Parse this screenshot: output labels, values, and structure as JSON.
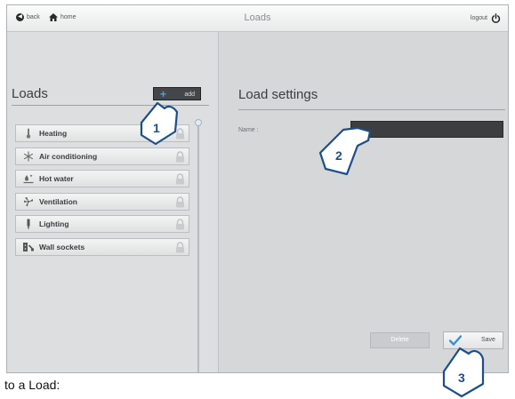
{
  "topbar": {
    "back_label": "back",
    "home_label": "home",
    "title": "Loads",
    "logout_label": "logout"
  },
  "loads_panel": {
    "heading": "Loads",
    "add_label": "add",
    "items": [
      {
        "label": "Heating",
        "icon": "thermometer-icon"
      },
      {
        "label": "Air conditioning",
        "icon": "snowflake-icon"
      },
      {
        "label": "Hot water",
        "icon": "water-heater-icon"
      },
      {
        "label": "Ventilation",
        "icon": "fan-icon"
      },
      {
        "label": "Lighting",
        "icon": "lamp-icon"
      },
      {
        "label": "Wall sockets",
        "icon": "socket-icon"
      }
    ]
  },
  "settings_panel": {
    "heading": "Load settings",
    "name_label": "Name :",
    "name_value": "",
    "delete_label": "Delete",
    "save_label": "Save"
  },
  "callouts": [
    "1",
    "2",
    "3"
  ],
  "caption": "to a Load:",
  "colors": {
    "accent": "#4aa3e0",
    "input_bg": "#3c3e40",
    "panel_bg": "#d2d4d6"
  }
}
